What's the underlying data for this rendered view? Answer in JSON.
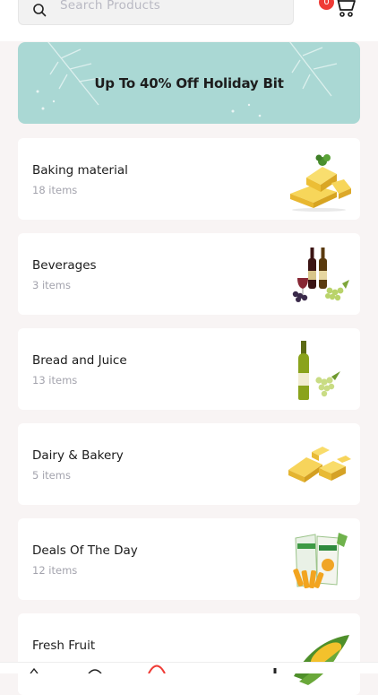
{
  "search": {
    "placeholder": "Search Products"
  },
  "cart": {
    "count": "0"
  },
  "banner": {
    "text": "Up To 40%  Off Holiday Bit"
  },
  "categories": [
    {
      "name": "Baking material",
      "count": "18 items",
      "icon": "cheese-image"
    },
    {
      "name": "Beverages",
      "count": "3 items",
      "icon": "wine-grapes-image"
    },
    {
      "name": "Bread and Juice",
      "count": "13 items",
      "icon": "wine-bottle-image"
    },
    {
      "name": "Dairy & Bakery",
      "count": "5 items",
      "icon": "cheese-cubes-image"
    },
    {
      "name": "Deals Of The Day",
      "count": "12 items",
      "icon": "snack-packs-image"
    },
    {
      "name": "Fresh Fruit",
      "count": "",
      "icon": "corn-image"
    }
  ],
  "colors": {
    "accent": "#ef3b35",
    "banner": "#aad8d4",
    "background": "#f8f4f4"
  }
}
